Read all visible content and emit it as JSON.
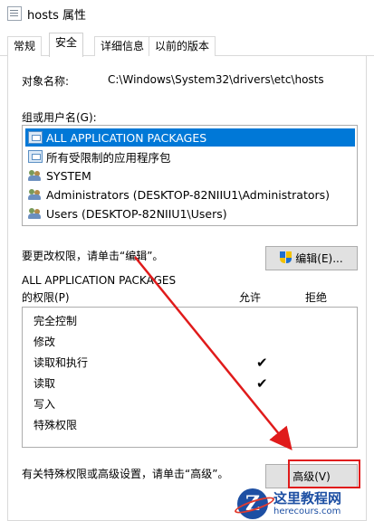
{
  "window": {
    "title": "hosts 属性",
    "icon": "file-icon"
  },
  "tabs": [
    {
      "label": "常规"
    },
    {
      "label": "安全"
    },
    {
      "label": "详细信息"
    },
    {
      "label": "以前的版本"
    }
  ],
  "security": {
    "object_name_label": "对象名称:",
    "object_name_value": "C:\\Windows\\System32\\drivers\\etc\\hosts",
    "group_label": "组或用户名(G):",
    "users": [
      {
        "name": "ALL APPLICATION PACKAGES",
        "icon": "package-icon",
        "selected": true
      },
      {
        "name": "所有受限制的应用程序包",
        "icon": "package-icon",
        "selected": false
      },
      {
        "name": "SYSTEM",
        "icon": "users-icon",
        "selected": false
      },
      {
        "name": "Administrators (DESKTOP-82NIIU1\\Administrators)",
        "icon": "users-icon",
        "selected": false
      },
      {
        "name": "Users (DESKTOP-82NIIU1\\Users)",
        "icon": "users-icon",
        "selected": false
      }
    ],
    "change_hint": "要更改权限，请单击“编辑”。",
    "edit_button": "编辑(E)...",
    "permissions_for": "ALL APPLICATION PACKAGES",
    "permissions_of": "的权限(P)",
    "col_allow": "允许",
    "col_deny": "拒绝",
    "permissions": [
      {
        "name": "完全控制",
        "allow": "",
        "deny": ""
      },
      {
        "name": "修改",
        "allow": "",
        "deny": ""
      },
      {
        "name": "读取和执行",
        "allow": "✔",
        "deny": ""
      },
      {
        "name": "读取",
        "allow": "✔",
        "deny": ""
      },
      {
        "name": "写入",
        "allow": "",
        "deny": ""
      },
      {
        "name": "特殊权限",
        "allow": "",
        "deny": ""
      }
    ],
    "special_hint": "有关特殊权限或高级设置，请单击“高级”。",
    "advanced_button": "高级(V)"
  },
  "watermark": {
    "name": "这里教程网",
    "url": "herecours.com",
    "logo_letter": "Z"
  },
  "colors": {
    "selection": "#0078d7",
    "annotation": "#e01b1b",
    "brand": "#1d4fa3"
  }
}
